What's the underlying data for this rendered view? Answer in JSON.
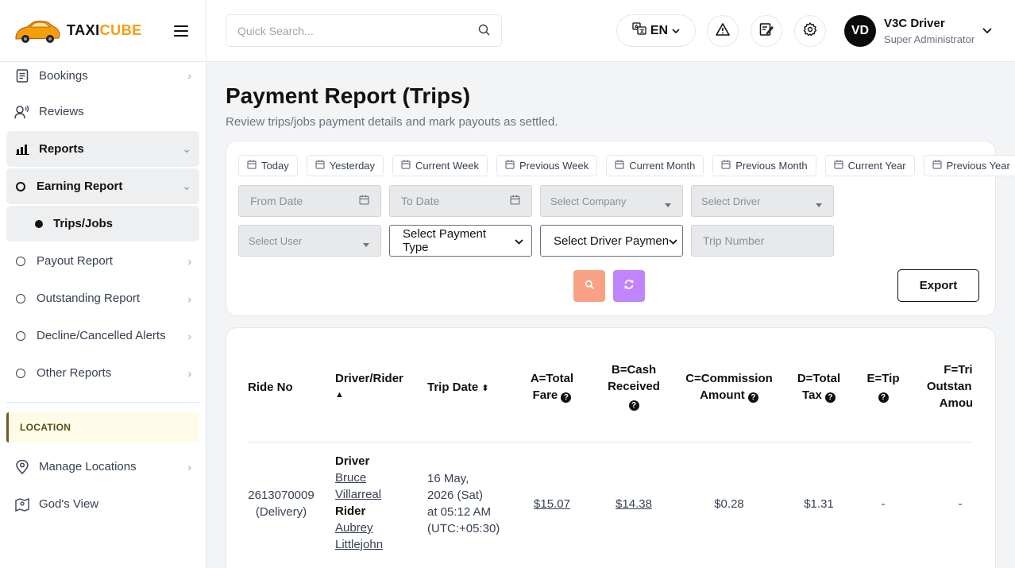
{
  "brand": {
    "name_part1": "TAXI",
    "name_part2": "CUBE"
  },
  "sidebar": {
    "items": [
      {
        "label": "Bookings"
      },
      {
        "label": "Reviews"
      },
      {
        "label": "Reports"
      },
      {
        "label": "Earning Report"
      },
      {
        "label": "Trips/Jobs"
      },
      {
        "label": "Payout Report"
      },
      {
        "label": "Outstanding Report"
      },
      {
        "label": "Decline/Cancelled Alerts"
      },
      {
        "label": "Other Reports"
      }
    ],
    "section_location": "LOCATION",
    "location_items": [
      {
        "label": "Manage Locations"
      },
      {
        "label": "God's View"
      }
    ]
  },
  "topbar": {
    "search_placeholder": "Quick Search...",
    "language": "EN",
    "user": {
      "initials": "VD",
      "name": "V3C Driver",
      "role": "Super Administrator"
    }
  },
  "page": {
    "title": "Payment Report (Trips)",
    "subtitle": "Review trips/jobs payment details and mark payouts as settled."
  },
  "filters": {
    "quick_ranges": [
      "Today",
      "Yesterday",
      "Current Week",
      "Previous Week",
      "Current Month",
      "Previous Month",
      "Current Year",
      "Previous Year"
    ],
    "from_date": "From Date",
    "to_date": "To Date",
    "company": "Select Company",
    "driver": "Select Driver",
    "user": "Select User",
    "payment_type": "Select Payment Type",
    "driver_payment": "Select Driver Paymen",
    "trip_number": "Trip Number",
    "export_label": "Export"
  },
  "table": {
    "headers": {
      "ride_no": "Ride No",
      "driver_rider": "Driver/Rider",
      "trip_date": "Trip Date",
      "total_fare_l1": "A=Total",
      "total_fare_l2": "Fare",
      "cash_l1": "B=Cash",
      "cash_l2": "Received",
      "commission_l1": "C=Commission",
      "commission_l2": "Amount",
      "tax_l1": "D=Total",
      "tax_l2": "Tax",
      "tip": "E=Tip",
      "outstanding_l1": "F=Trip",
      "outstanding_l2": "Outstanding",
      "outstanding_l3": "Amount"
    },
    "rows": [
      {
        "ride_no": "2613070009",
        "ride_type": "(Delivery)",
        "driver_label": "Driver",
        "driver_first": "Bruce",
        "driver_last": "Villarreal",
        "rider_label": "Rider",
        "rider_first": "Aubrey",
        "rider_last": "Littlejohn",
        "date_l1": "16 May,",
        "date_l2": "2026 (Sat)",
        "date_l3": "at 05:12 AM",
        "date_l4": "(UTC:+05:30)",
        "total_fare": "$15.07",
        "cash_received": "$14.38",
        "commission": "$0.28",
        "tax": "$1.31",
        "tip": "-",
        "outstanding": "-"
      }
    ]
  }
}
